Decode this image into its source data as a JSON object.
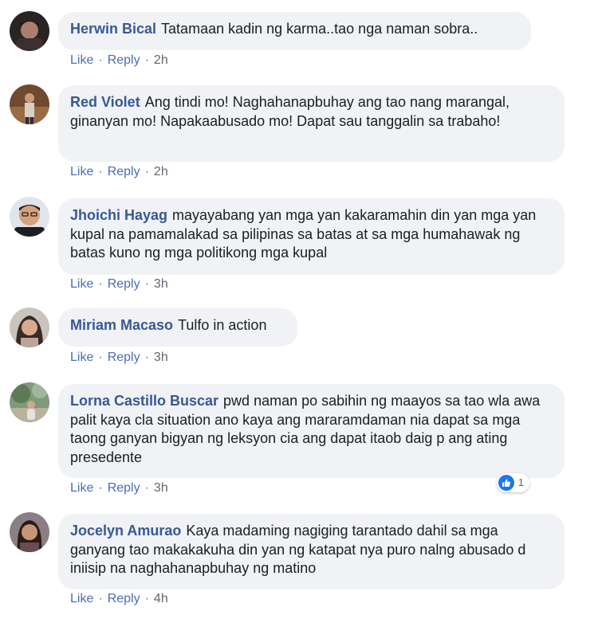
{
  "actions": {
    "like": "Like",
    "reply": "Reply",
    "separator": "·"
  },
  "comments": [
    {
      "author": "Herwin Bical",
      "text": "Tatamaan kadin ng karma..tao nga naman sobra..",
      "time": "2h"
    },
    {
      "author": "Red Violet",
      "text": "Ang tindi mo! Naghahanapbuhay ang tao nang marangal, ginanyan mo! Napakaabusado mo! Dapat sau tanggalin sa trabaho!",
      "time": "2h"
    },
    {
      "author": "Jhoichi Hayag",
      "text": "mayayabang yan mga yan kakaramahin din yan mga yan kupal na pamamalakad sa pilipinas sa batas at sa mga humahawak ng batas kuno ng mga politikong mga kupal",
      "time": "3h"
    },
    {
      "author": "Miriam Macaso",
      "text": "Tulfo in action",
      "time": "3h"
    },
    {
      "author": "Lorna Castillo Buscar",
      "text": "pwd naman po sabihin ng maayos sa tao wla awa palit kaya cla situation ano kaya ang mararamdaman nia dapat sa mga taong ganyan bigyan ng leksyon cia ang dapat itaob daig p ang ating presedente",
      "time": "3h",
      "reaction_count": "1",
      "reaction_icon": "like-icon"
    },
    {
      "author": "Jocelyn Amurao",
      "text": "Kaya madaming nagiging tarantado dahil sa mga ganyang tao makakakuha din yan ng katapat nya puro nalng abusado d iniisip na naghahanapbuhay ng matino",
      "time": "4h"
    }
  ],
  "colors": {
    "author": "#385898",
    "bubble": "#f0f2f5",
    "link": "#4b6cb7",
    "like_reaction": "#1877f2"
  }
}
